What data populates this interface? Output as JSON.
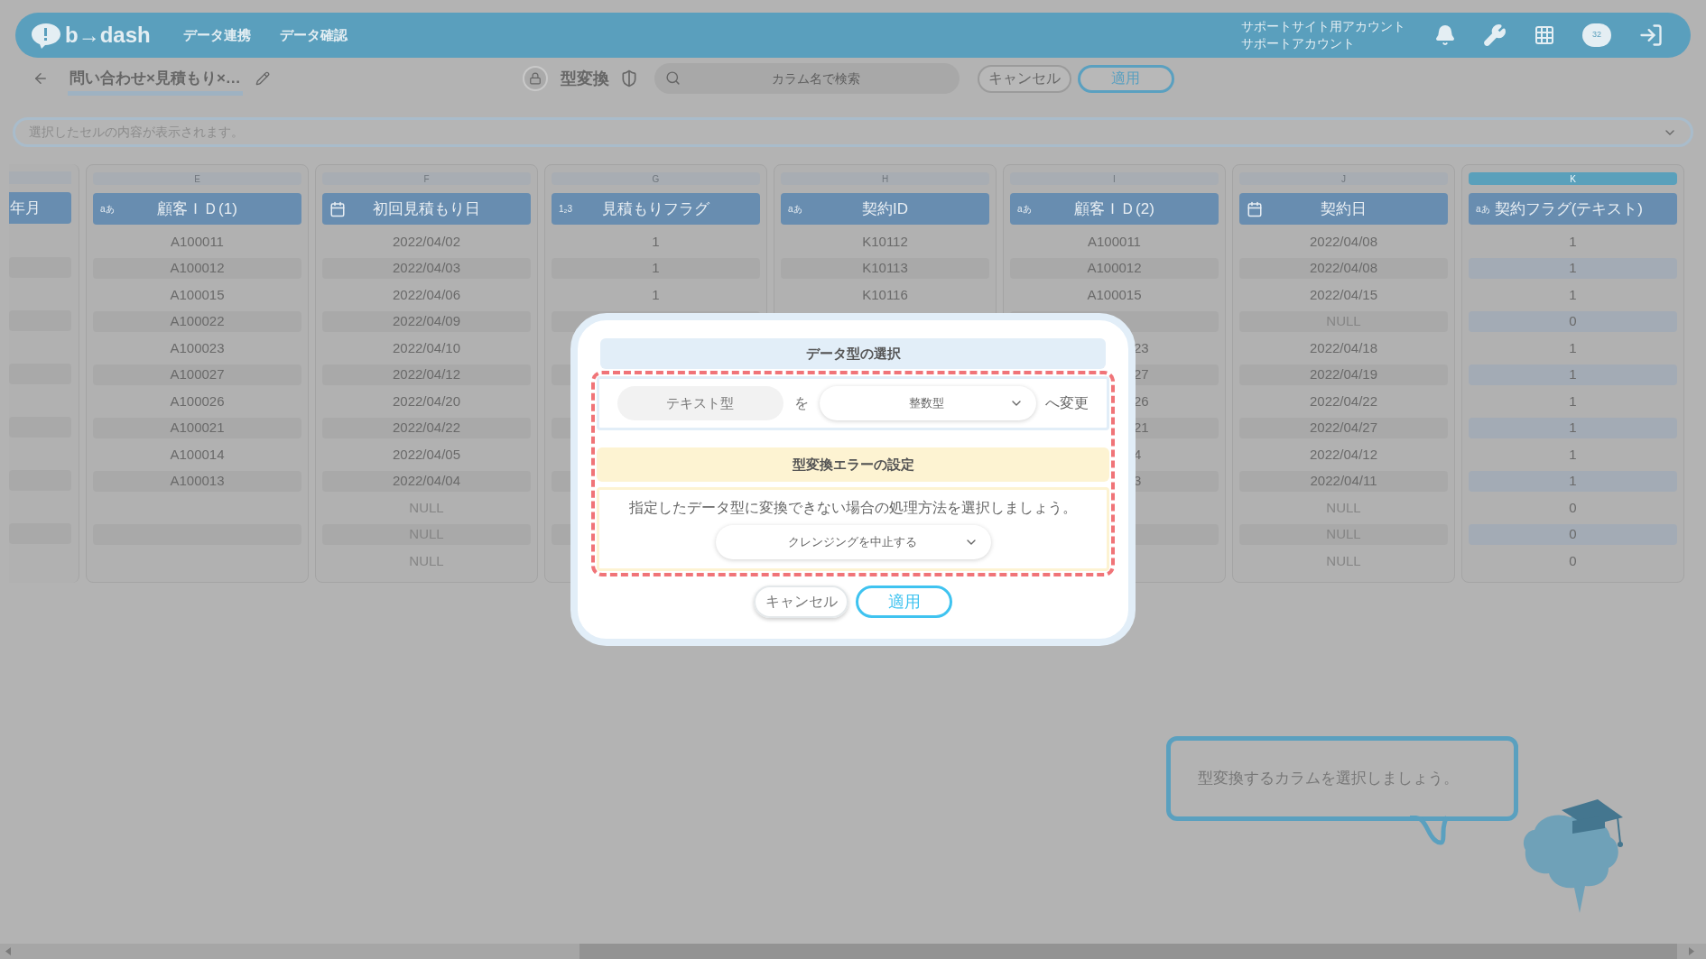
{
  "header": {
    "logo": "b→dash",
    "nav": [
      "データ連携",
      "データ確認"
    ],
    "account": [
      "サポートサイト用アカウント",
      "サポートアカウント"
    ],
    "badge": "32"
  },
  "toolbar": {
    "title": "問い合わせ×見積もり×…",
    "mode": "型変換",
    "search": {
      "placeholder": "カラム名で検索"
    },
    "buttons": [
      "キャンセル",
      "適用"
    ]
  },
  "cell_viewer": {
    "placeholder": "選択したセルの内容が表示されます。"
  },
  "table": {
    "columns": [
      {
        "kind": "cut",
        "name": "年月",
        "selected": false,
        "cells": [
          null,
          null,
          null,
          null,
          null,
          null,
          null,
          null,
          null,
          null,
          null,
          null,
          null
        ]
      },
      {
        "letter": "E",
        "header_icon": {
          "kind": "text",
          "label": "aあ"
        },
        "name": "顧客ＩＤ(1)",
        "selected": false,
        "cells": [
          "A100011",
          "A100012",
          "A100015",
          "A100022",
          "A100023",
          "A100027",
          "A100026",
          "A100021",
          "A100014",
          "A100013",
          null,
          null,
          null
        ]
      },
      {
        "letter": "F",
        "header_icon": {
          "kind": "date"
        },
        "name": "初回見積もり日",
        "selected": false,
        "cells": [
          "2022/04/02",
          "2022/04/03",
          "2022/04/06",
          "2022/04/09",
          "2022/04/10",
          "2022/04/12",
          "2022/04/20",
          "2022/04/22",
          "2022/04/05",
          "2022/04/04",
          {
            "text": "NULL",
            "kind": "null"
          },
          {
            "text": "NULL",
            "kind": "null"
          },
          {
            "text": "NULL",
            "kind": "null"
          }
        ]
      },
      {
        "letter": "G",
        "header_icon": {
          "kind": "number",
          "label": "1₂3"
        },
        "name": "見積もりフラグ",
        "selected": false,
        "cells": [
          "1",
          "1",
          "1",
          null,
          null,
          null,
          null,
          null,
          null,
          null,
          null,
          null,
          null
        ]
      },
      {
        "letter": "H",
        "header_icon": {
          "kind": "text",
          "label": "aあ"
        },
        "name": "契約ID",
        "selected": false,
        "cells": [
          "K10112",
          "K10113",
          "K10116"
        ]
      },
      {
        "letter": "I",
        "header_icon": {
          "kind": "text",
          "label": "aあ"
        },
        "name": "顧客ＩＤ(2)",
        "selected": false,
        "cells": [
          "A100011",
          "A100012",
          "A100015",
          null,
          {
            "text": "23",
            "kind": "cut"
          },
          {
            "text": "27",
            "kind": "cut"
          },
          {
            "text": "26",
            "kind": "cut"
          },
          {
            "text": "21",
            "kind": "cut"
          },
          {
            "text": "4",
            "kind": "cut"
          },
          {
            "text": "3",
            "kind": "cut"
          },
          null,
          null,
          null
        ]
      },
      {
        "letter": "J",
        "header_icon": {
          "kind": "date"
        },
        "name": "契約日",
        "selected": false,
        "cells": [
          "2022/04/08",
          "2022/04/08",
          "2022/04/15",
          {
            "text": "NULL",
            "kind": "null"
          },
          "2022/04/18",
          "2022/04/19",
          "2022/04/22",
          "2022/04/27",
          "2022/04/12",
          "2022/04/11",
          {
            "text": "NULL",
            "kind": "null"
          },
          {
            "text": "NULL",
            "kind": "null"
          },
          {
            "text": "NULL",
            "kind": "null"
          }
        ]
      },
      {
        "letter": "K",
        "header_icon": {
          "kind": "text",
          "label": "aあ"
        },
        "name": "契約フラグ(テキスト)",
        "selected": true,
        "cells": [
          "1",
          "1",
          "1",
          "0",
          "1",
          "1",
          "1",
          "1",
          "1",
          "1",
          "0",
          "0",
          "0"
        ]
      }
    ]
  },
  "modal": {
    "title": "データ型の選択",
    "source_type": "テキスト型",
    "particle": "を",
    "target_type": "整数型",
    "suffix": "へ変更",
    "error_title": "型変換エラーの設定",
    "message": "指定したデータ型に変換できない場合の処理方法を選択しましょう。",
    "error_action": "クレンジングを中止する",
    "buttons": [
      "キャンセル",
      "適用"
    ]
  },
  "guide": {
    "text": "型変換するカラムを選択しましょう。"
  }
}
